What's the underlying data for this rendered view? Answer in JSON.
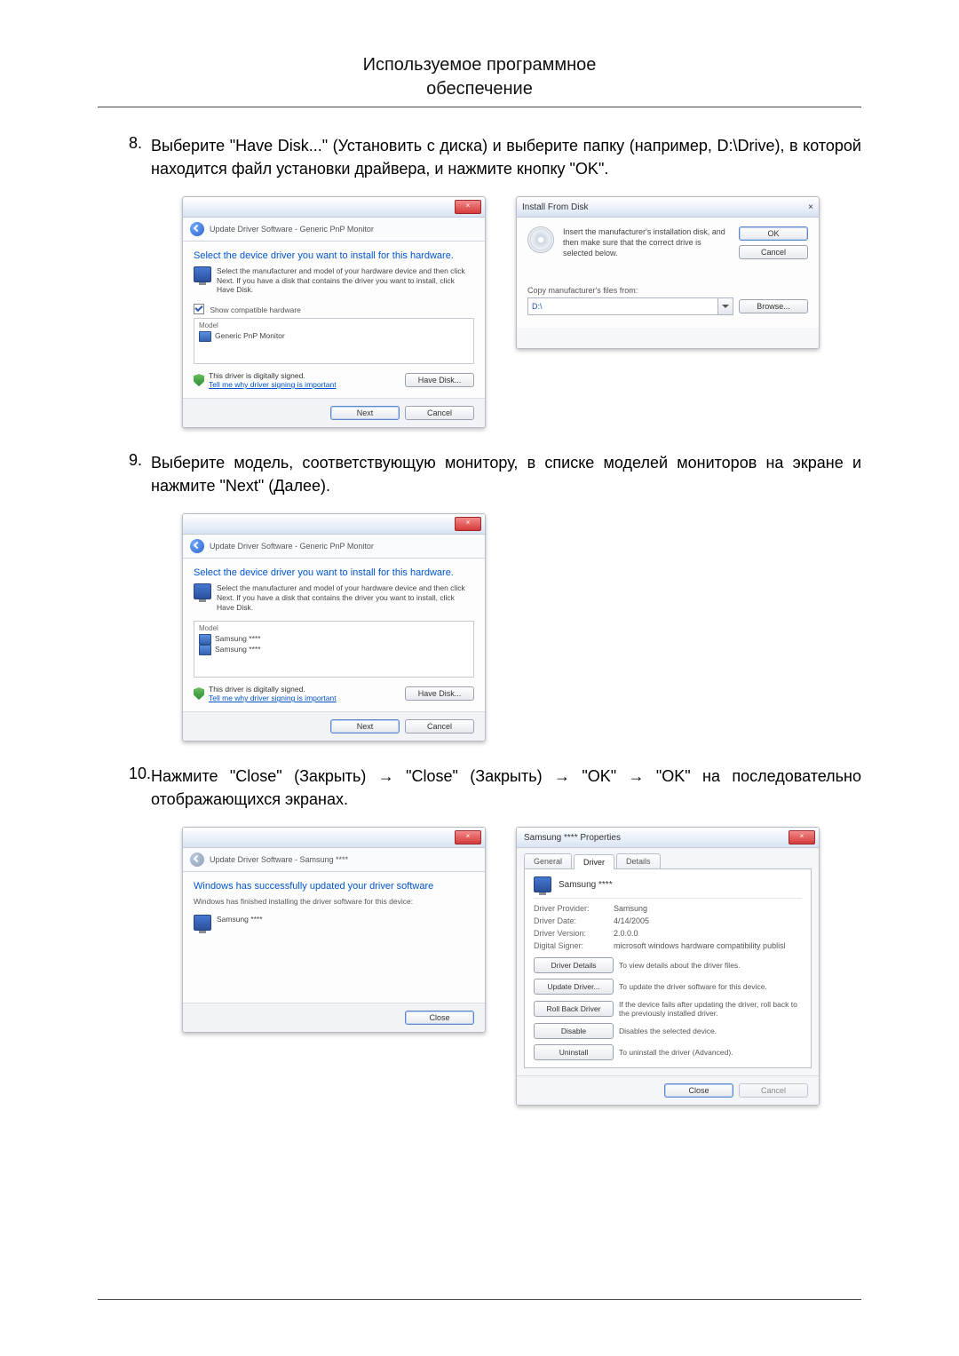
{
  "header": {
    "line1": "Используемое программное",
    "line2": "обеспечение"
  },
  "steps": {
    "s8": {
      "num": "8.",
      "text": "Выберите \"Have Disk...\" (Установить с диска) и выберите папку (например, D:\\Drive), в которой находится файл установки драйвера, и нажмите кнопку \"OK\"."
    },
    "s9": {
      "num": "9.",
      "text": "Выберите модель, соответствующую монитору, в списке моделей мониторов на экране и нажмите \"Next\" (Далее)."
    },
    "s10": {
      "num": "10.",
      "text": "Нажмите \"Close\" (Закрыть) → \"Close\" (Закрыть) → \"OK\" → \"OK\" на последовательно отображающихся экранах."
    }
  },
  "wiz": {
    "crumb_generic": "Update Driver Software - Generic PnP Monitor",
    "crumb_samsung": "Update Driver Software - Samsung ****",
    "close_glyph": "×",
    "select_instr": "Select the device driver you want to install for this hardware.",
    "sub_text": "Select the manufacturer and model of your hardware device and then click Next. If you have a disk that contains the driver you want to install, click Have Disk.",
    "show_compatible": "Show compatible hardware",
    "model_hdr": "Model",
    "model_generic": "Generic PnP Monitor",
    "model_sams": "Samsung ****",
    "signed": "This driver is digitally signed.",
    "why_link": "Tell me why driver signing is important",
    "have_disk_btn": "Have Disk...",
    "next_btn": "Next",
    "cancel_btn": "Cancel",
    "close_btn": "Close",
    "success_title": "Windows has successfully updated your driver software",
    "success_sub": "Windows has finished installing the driver software for this device:"
  },
  "ifd": {
    "title": "Install From Disk",
    "msg": "Insert the manufacturer's installation disk, and then make sure that the correct drive is selected below.",
    "ok": "OK",
    "cancel": "Cancel",
    "copy_label": "Copy manufacturer's files from:",
    "path": "D:\\",
    "browse": "Browse..."
  },
  "props": {
    "title": "Samsung **** Properties",
    "tab_general": "General",
    "tab_driver": "Driver",
    "tab_details": "Details",
    "device": "Samsung ****",
    "provider_k": "Driver Provider:",
    "provider_v": "Samsung",
    "date_k": "Driver Date:",
    "date_v": "4/14/2005",
    "version_k": "Driver Version:",
    "version_v": "2.0.0.0",
    "signer_k": "Digital Signer:",
    "signer_v": "microsoft windows hardware compatibility publisl",
    "details_btn": "Driver Details",
    "details_desc": "To view details about the driver files.",
    "update_btn": "Update Driver...",
    "update_desc": "To update the driver software for this device.",
    "rollback_btn": "Roll Back Driver",
    "rollback_desc": "If the device fails after updating the driver, roll back to the previously installed driver.",
    "disable_btn": "Disable",
    "disable_desc": "Disables the selected device.",
    "uninstall_btn": "Uninstall",
    "uninstall_desc": "To uninstall the driver (Advanced).",
    "close_btn": "Close",
    "cancel_btn": "Cancel"
  }
}
